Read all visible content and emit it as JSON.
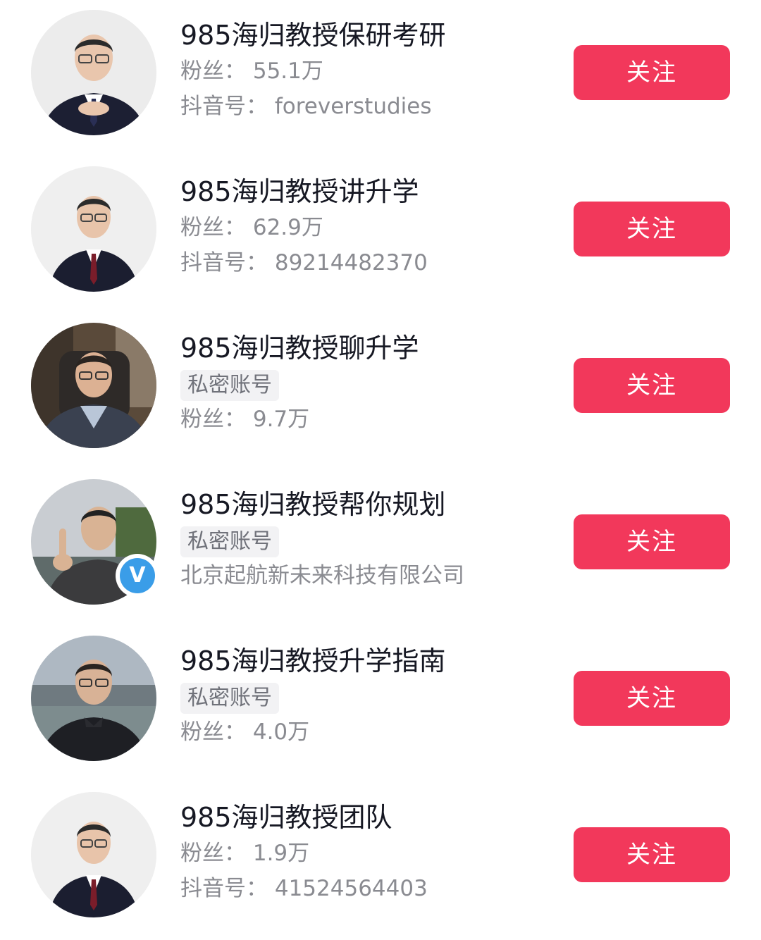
{
  "accounts": [
    {
      "name": "985海归教授保研考研",
      "lines": [
        "粉丝：  55.1万",
        "抖音号：  foreverstudies"
      ],
      "private_label": "",
      "verified": false,
      "follow_label": "关注"
    },
    {
      "name": "985海归教授讲升学",
      "lines": [
        "粉丝：  62.9万",
        "抖音号：  89214482370"
      ],
      "private_label": "",
      "verified": false,
      "follow_label": "关注"
    },
    {
      "name": "985海归教授聊升学",
      "lines": [
        "粉丝：  9.7万"
      ],
      "private_label": "私密账号",
      "verified": false,
      "follow_label": "关注"
    },
    {
      "name": "985海归教授帮你规划",
      "lines": [
        "北京起航新未来科技有限公司"
      ],
      "private_label": "私密账号",
      "verified": true,
      "verified_mark": "V",
      "follow_label": "关注"
    },
    {
      "name": "985海归教授升学指南",
      "lines": [
        "粉丝：  4.0万"
      ],
      "private_label": "私密账号",
      "verified": false,
      "follow_label": "关注"
    },
    {
      "name": "985海归教授团队",
      "lines": [
        "粉丝：  1.9万",
        "抖音号：  41524564403"
      ],
      "private_label": "",
      "verified": false,
      "follow_label": "关注"
    }
  ],
  "colors": {
    "follow_button": "#f2385b",
    "name_text": "#161823",
    "secondary_text": "#8a8b91",
    "verified_badge": "#3a9de8"
  }
}
